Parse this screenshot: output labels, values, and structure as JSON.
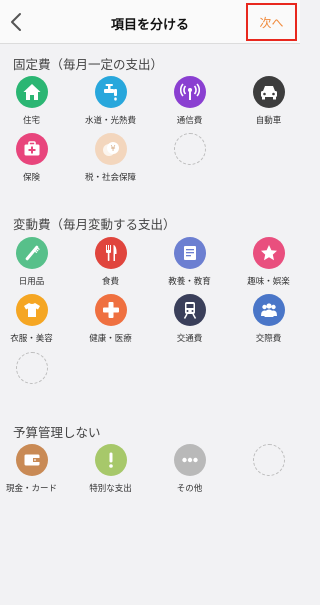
{
  "header": {
    "title": "項目を分ける",
    "next_label": "次へ"
  },
  "colors": {
    "accent_orange": "#f08a3c",
    "highlight_red": "#e8281e"
  },
  "sections": {
    "fixed": {
      "title": "固定費（毎月一定の支出）",
      "items": [
        {
          "label": "住宅",
          "icon": "house-icon",
          "color": "#2bb673"
        },
        {
          "label": "水道・光熱費",
          "icon": "faucet-icon",
          "color": "#28a7dc"
        },
        {
          "label": "通信費",
          "icon": "antenna-icon",
          "color": "#8a3fd1"
        },
        {
          "label": "自動車",
          "icon": "car-icon",
          "color": "#3d3d3d"
        },
        {
          "label": "保険",
          "icon": "medical-case-icon",
          "color": "#e8457c"
        },
        {
          "label": "税・社会保障",
          "icon": "yen-coin-icon",
          "color": "#f3d6bd"
        }
      ]
    },
    "variable": {
      "title": "変動費（毎月変動する支出）",
      "items": [
        {
          "label": "日用品",
          "icon": "toothbrush-icon",
          "color": "#57c08a"
        },
        {
          "label": "食費",
          "icon": "fork-knife-icon",
          "color": "#e0453d"
        },
        {
          "label": "教養・教育",
          "icon": "book-icon",
          "color": "#6c7fd1"
        },
        {
          "label": "趣味・娯楽",
          "icon": "star-icon",
          "color": "#e94f7e"
        },
        {
          "label": "衣服・美容",
          "icon": "tshirt-icon",
          "color": "#f5a623"
        },
        {
          "label": "健康・医療",
          "icon": "cross-icon",
          "color": "#ef7040"
        },
        {
          "label": "交通費",
          "icon": "train-icon",
          "color": "#3a3f5a"
        },
        {
          "label": "交際費",
          "icon": "people-icon",
          "color": "#4a76c8"
        }
      ]
    },
    "unmanaged": {
      "title": "予算管理しない",
      "items": [
        {
          "label": "現金・カード",
          "icon": "wallet-icon",
          "color": "#c98a55"
        },
        {
          "label": "特別な支出",
          "icon": "exclamation-icon",
          "color": "#a7c86a"
        },
        {
          "label": "その他",
          "icon": "dots-icon",
          "color": "#b9b9b9"
        }
      ]
    }
  }
}
